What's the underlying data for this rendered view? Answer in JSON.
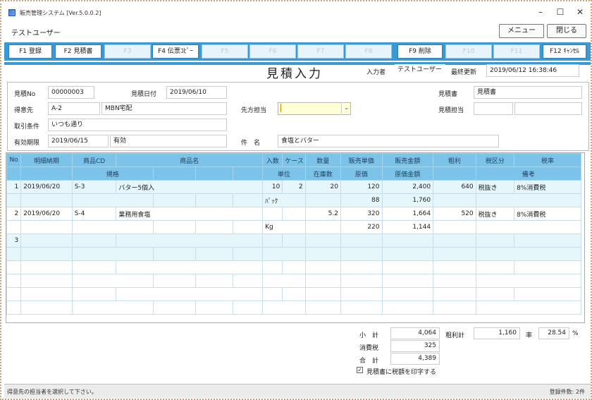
{
  "window": {
    "title": "販売管理システム [Ver.5.0.0.2]",
    "minimize": "–",
    "maximize": "☐",
    "close": "✕"
  },
  "user": "テストユーザー",
  "buttons": {
    "menu": "メニュー",
    "close": "閉じる"
  },
  "fkeys": [
    {
      "label": "F1 登録",
      "enabled": true
    },
    {
      "label": "F2 見積書",
      "enabled": true
    },
    {
      "label": "F3",
      "enabled": false
    },
    {
      "label": "F4 伝票ｺﾋﾟｰ",
      "enabled": true
    },
    {
      "label": "F5",
      "enabled": false
    },
    {
      "label": "F6",
      "enabled": false
    },
    {
      "label": "F7",
      "enabled": false
    },
    {
      "label": "F8",
      "enabled": false
    },
    {
      "label": "F9 削除",
      "enabled": true
    },
    {
      "label": "F10",
      "enabled": false
    },
    {
      "label": "F11",
      "enabled": false
    },
    {
      "label": "F12 ｷｬﾝｾﾙ",
      "enabled": true
    }
  ],
  "header": {
    "title": "見積入力",
    "input_by_label": "入力者",
    "input_by": "テストユーザー",
    "last_updated_label": "最終更新",
    "last_updated": "2019/06/12 16:38:46"
  },
  "form": {
    "quote_no_label": "見積No",
    "quote_no": "00000003",
    "quote_date_label": "見積日付",
    "quote_date": "2019/06/10",
    "customer_label": "得意先",
    "customer_code": "A-2",
    "customer_name": "MBN宅配",
    "contact_label": "先方担当",
    "contact": "",
    "terms_label": "取引条件",
    "terms": "いつも通り",
    "expiry_label": "有効期限",
    "expiry": "2019/06/15",
    "expiry_status": "有効",
    "subject_label": "件　名",
    "subject": "食塩とバター",
    "quote_doc_label": "見積書",
    "quote_doc": "見積書",
    "quote_staff_label": "見積担当",
    "quote_staff": ""
  },
  "grid": {
    "head1": [
      "No",
      "明細納期",
      "商品CD",
      "商品名",
      "入数",
      "ケース",
      "数量",
      "販売単価",
      "販売金額",
      "粗利",
      "税区分",
      "税率"
    ],
    "head2": [
      "規格",
      "単位",
      "在庫数",
      "原価",
      "原価金額",
      "備考"
    ],
    "rows": [
      {
        "no": "1",
        "date": "2019/06/20",
        "code": "S-3",
        "name": "バター5個入",
        "irisu": "10",
        "case": "2",
        "qty": "20",
        "price": "120",
        "amount": "2,400",
        "profit": "640",
        "tax_type": "税抜き",
        "tax_rate": "8%消費税",
        "spec": "",
        "unit": "ﾊﾟｯｸ",
        "stock": "",
        "cost": "88",
        "cost_amount": "1,760",
        "note": ""
      },
      {
        "no": "2",
        "date": "2019/06/20",
        "code": "S-4",
        "name": "業務用食塩",
        "irisu": "",
        "case": "",
        "qty": "5.2",
        "price": "320",
        "amount": "1,664",
        "profit": "520",
        "tax_type": "税抜き",
        "tax_rate": "8%消費税",
        "spec": "",
        "unit": "Kg",
        "stock": "",
        "cost": "220",
        "cost_amount": "1,144",
        "note": ""
      },
      {
        "no": "3",
        "date": "",
        "code": "",
        "name": "",
        "irisu": "",
        "case": "",
        "qty": "",
        "price": "",
        "amount": "",
        "profit": "",
        "tax_type": "",
        "tax_rate": "",
        "spec": "",
        "unit": "",
        "stock": "",
        "cost": "",
        "cost_amount": "",
        "note": ""
      }
    ]
  },
  "totals": {
    "subtotal_label": "小　計",
    "subtotal": "4,064",
    "tax_label": "消費税",
    "tax": "325",
    "total_label": "合　計",
    "total": "4,389",
    "profit_label": "粗利計",
    "profit": "1,160",
    "rate_label": "率",
    "rate": "28.54",
    "rate_unit": "%",
    "print_tax_label": "見積書に税額を印字する",
    "print_tax_checked": true
  },
  "status": {
    "message": "得意先の担当者を選択して下さい。",
    "count": "登録件数: 2件"
  }
}
